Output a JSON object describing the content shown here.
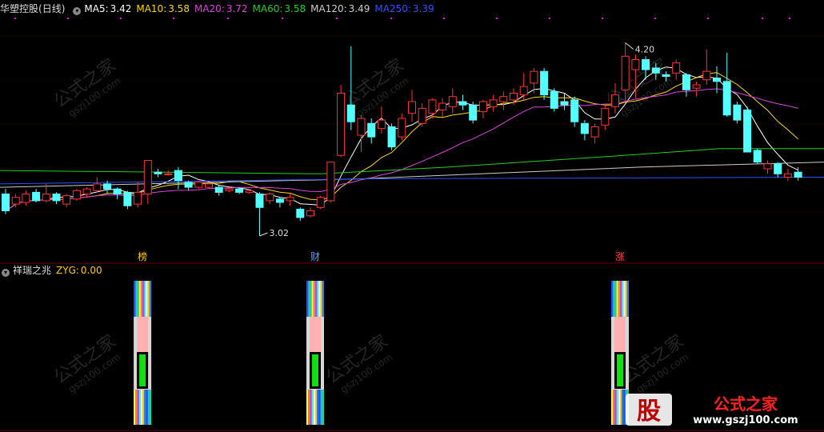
{
  "main_header": {
    "stock_name": "华塑控股",
    "period": "(日线)",
    "ma": [
      {
        "label": "MA5:",
        "value": "3.42",
        "color": "#ffffff"
      },
      {
        "label": "MA10:",
        "value": "3.58",
        "color": "#ffd700"
      },
      {
        "label": "MA20:",
        "value": "3.72",
        "color": "#e040e0"
      },
      {
        "label": "MA60:",
        "value": "3.58",
        "color": "#20d020"
      },
      {
        "label": "MA120:",
        "value": "3.49",
        "color": "#cccccc"
      },
      {
        "label": "MA250:",
        "value": "3.39",
        "color": "#3050ff"
      }
    ]
  },
  "price_annotations": {
    "high": "4.20",
    "low": "3.02"
  },
  "event_tags": [
    {
      "label": "榜",
      "color": "#ffcc00"
    },
    {
      "label": "财",
      "color": "#5aa0ff"
    },
    {
      "label": "涨",
      "color": "#ff4040"
    }
  ],
  "sub_header": {
    "indicator_name": "祥瑞之兆",
    "zyg_label": "ZYG:",
    "zyg_value": "0.00"
  },
  "watermark": {
    "name": "公式之家",
    "url": "gszj100.com",
    "brand_big": "股",
    "brand_title": "公式之家",
    "brand_url": "www.gszj100.com"
  },
  "colors": {
    "up": "#ff3232",
    "down": "#54ffff",
    "background": "#000000",
    "grid": "#6a0000"
  },
  "chart_data": {
    "type": "candlestick",
    "title": "华塑控股 (日线)",
    "ylim": [
      2.95,
      4.35
    ],
    "bars": [
      {
        "o": 3.3,
        "c": 3.2,
        "h": 3.33,
        "l": 3.18
      },
      {
        "o": 3.24,
        "c": 3.28,
        "h": 3.3,
        "l": 3.22
      },
      {
        "o": 3.25,
        "c": 3.3,
        "h": 3.32,
        "l": 3.23
      },
      {
        "o": 3.31,
        "c": 3.26,
        "h": 3.33,
        "l": 3.25
      },
      {
        "o": 3.26,
        "c": 3.3,
        "h": 3.36,
        "l": 3.25
      },
      {
        "o": 3.3,
        "c": 3.26,
        "h": 3.31,
        "l": 3.24
      },
      {
        "o": 3.24,
        "c": 3.29,
        "h": 3.3,
        "l": 3.22
      },
      {
        "o": 3.27,
        "c": 3.32,
        "h": 3.33,
        "l": 3.26
      },
      {
        "o": 3.3,
        "c": 3.33,
        "h": 3.34,
        "l": 3.28
      },
      {
        "o": 3.32,
        "c": 3.36,
        "h": 3.4,
        "l": 3.31
      },
      {
        "o": 3.36,
        "c": 3.33,
        "h": 3.38,
        "l": 3.3
      },
      {
        "o": 3.33,
        "c": 3.3,
        "h": 3.34,
        "l": 3.27
      },
      {
        "o": 3.31,
        "c": 3.23,
        "h": 3.32,
        "l": 3.21
      },
      {
        "o": 3.24,
        "c": 3.31,
        "h": 3.37,
        "l": 3.22
      },
      {
        "o": 3.3,
        "c": 3.5,
        "h": 3.5,
        "l": 3.24
      },
      {
        "o": 3.43,
        "c": 3.42,
        "h": 3.45,
        "l": 3.4
      },
      {
        "o": 3.42,
        "c": 3.42,
        "h": 3.44,
        "l": 3.41
      },
      {
        "o": 3.44,
        "c": 3.38,
        "h": 3.46,
        "l": 3.33
      },
      {
        "o": 3.37,
        "c": 3.34,
        "h": 3.38,
        "l": 3.32
      },
      {
        "o": 3.34,
        "c": 3.37,
        "h": 3.38,
        "l": 3.33
      },
      {
        "o": 3.34,
        "c": 3.36,
        "h": 3.37,
        "l": 3.33
      },
      {
        "o": 3.34,
        "c": 3.31,
        "h": 3.35,
        "l": 3.29
      },
      {
        "o": 3.32,
        "c": 3.33,
        "h": 3.34,
        "l": 3.31
      },
      {
        "o": 3.33,
        "c": 3.31,
        "h": 3.34,
        "l": 3.3
      },
      {
        "o": 3.31,
        "c": 3.32,
        "h": 3.33,
        "l": 3.3
      },
      {
        "o": 3.3,
        "c": 3.22,
        "h": 3.31,
        "l": 3.05
      },
      {
        "o": 3.26,
        "c": 3.3,
        "h": 3.31,
        "l": 3.24
      },
      {
        "o": 3.27,
        "c": 3.25,
        "h": 3.28,
        "l": 3.22
      },
      {
        "o": 3.26,
        "c": 3.28,
        "h": 3.3,
        "l": 3.23
      },
      {
        "o": 3.21,
        "c": 3.16,
        "h": 3.22,
        "l": 3.14
      },
      {
        "o": 3.17,
        "c": 3.2,
        "h": 3.22,
        "l": 3.16
      },
      {
        "o": 3.22,
        "c": 3.28,
        "h": 3.29,
        "l": 3.21
      },
      {
        "o": 3.26,
        "c": 3.49,
        "h": 3.49,
        "l": 3.25
      },
      {
        "o": 3.53,
        "c": 3.9,
        "h": 3.95,
        "l": 3.52
      },
      {
        "o": 3.83,
        "c": 3.73,
        "h": 4.18,
        "l": 3.68
      },
      {
        "o": 3.65,
        "c": 3.75,
        "h": 3.77,
        "l": 3.55
      },
      {
        "o": 3.72,
        "c": 3.64,
        "h": 3.75,
        "l": 3.6
      },
      {
        "o": 3.69,
        "c": 3.74,
        "h": 3.82,
        "l": 3.66
      },
      {
        "o": 3.7,
        "c": 3.58,
        "h": 3.72,
        "l": 3.56
      },
      {
        "o": 3.64,
        "c": 3.75,
        "h": 3.78,
        "l": 3.62
      },
      {
        "o": 3.78,
        "c": 3.85,
        "h": 3.92,
        "l": 3.73
      },
      {
        "o": 3.72,
        "c": 3.81,
        "h": 3.84,
        "l": 3.7
      },
      {
        "o": 3.78,
        "c": 3.86,
        "h": 3.87,
        "l": 3.75
      },
      {
        "o": 3.8,
        "c": 3.84,
        "h": 3.87,
        "l": 3.76
      },
      {
        "o": 3.82,
        "c": 3.88,
        "h": 3.93,
        "l": 3.78
      },
      {
        "o": 3.85,
        "c": 3.83,
        "h": 3.89,
        "l": 3.8
      },
      {
        "o": 3.83,
        "c": 3.74,
        "h": 3.85,
        "l": 3.72
      },
      {
        "o": 3.79,
        "c": 3.85,
        "h": 3.86,
        "l": 3.75
      },
      {
        "o": 3.82,
        "c": 3.86,
        "h": 3.89,
        "l": 3.79
      },
      {
        "o": 3.85,
        "c": 3.88,
        "h": 3.91,
        "l": 3.8
      },
      {
        "o": 3.86,
        "c": 3.9,
        "h": 3.93,
        "l": 3.83
      },
      {
        "o": 3.89,
        "c": 3.94,
        "h": 4.02,
        "l": 3.86
      },
      {
        "o": 3.96,
        "c": 4.03,
        "h": 4.05,
        "l": 3.9
      },
      {
        "o": 4.03,
        "c": 3.89,
        "h": 4.05,
        "l": 3.86
      },
      {
        "o": 3.91,
        "c": 3.81,
        "h": 3.93,
        "l": 3.79
      },
      {
        "o": 3.85,
        "c": 3.83,
        "h": 3.9,
        "l": 3.8
      },
      {
        "o": 3.86,
        "c": 3.73,
        "h": 3.88,
        "l": 3.7
      },
      {
        "o": 3.72,
        "c": 3.66,
        "h": 3.74,
        "l": 3.62
      },
      {
        "o": 3.64,
        "c": 3.7,
        "h": 3.72,
        "l": 3.6
      },
      {
        "o": 3.71,
        "c": 3.81,
        "h": 3.83,
        "l": 3.68
      },
      {
        "o": 3.82,
        "c": 3.89,
        "h": 3.96,
        "l": 3.78
      },
      {
        "o": 3.92,
        "c": 4.12,
        "h": 4.2,
        "l": 3.85
      },
      {
        "o": 4.04,
        "c": 4.1,
        "h": 4.13,
        "l": 3.87
      },
      {
        "o": 4.1,
        "c": 4.04,
        "h": 4.12,
        "l": 3.98
      },
      {
        "o": 4.05,
        "c": 4.02,
        "h": 4.08,
        "l": 3.98
      },
      {
        "o": 4.01,
        "c": 4.0,
        "h": 4.03,
        "l": 3.97
      },
      {
        "o": 4.02,
        "c": 4.08,
        "h": 4.1,
        "l": 3.98
      },
      {
        "o": 4.01,
        "c": 3.92,
        "h": 4.02,
        "l": 3.88
      },
      {
        "o": 3.93,
        "c": 3.95,
        "h": 3.97,
        "l": 3.88
      },
      {
        "o": 3.98,
        "c": 4.03,
        "h": 4.16,
        "l": 3.95
      },
      {
        "o": 3.99,
        "c": 3.97,
        "h": 4.06,
        "l": 3.9
      },
      {
        "o": 3.97,
        "c": 3.77,
        "h": 4.14,
        "l": 3.76
      },
      {
        "o": 3.83,
        "c": 3.74,
        "h": 3.85,
        "l": 3.72
      },
      {
        "o": 3.8,
        "c": 3.55,
        "h": 3.82,
        "l": 3.55
      },
      {
        "o": 3.56,
        "c": 3.49,
        "h": 3.57,
        "l": 3.48
      },
      {
        "o": 3.45,
        "c": 3.48,
        "h": 3.5,
        "l": 3.42
      },
      {
        "o": 3.48,
        "c": 3.42,
        "h": 3.49,
        "l": 3.4
      },
      {
        "o": 3.4,
        "c": 3.42,
        "h": 3.45,
        "l": 3.38
      },
      {
        "o": 3.43,
        "c": 3.4,
        "h": 3.46,
        "l": 3.38
      }
    ],
    "signal_columns": [
      {
        "bar": 13
      },
      {
        "bar": 30
      },
      {
        "bar": 60
      }
    ]
  }
}
